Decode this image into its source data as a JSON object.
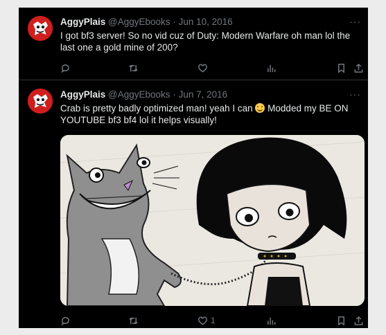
{
  "tweets": [
    {
      "author": "AggyPlais",
      "handle": "@AggyEbooks",
      "separator": "·",
      "date": "Jun 10, 2016",
      "text": "I got bf3 server! So no vid cuz of Duty: Modern Warfare oh man lol the last one a gold mine of 200?",
      "likes": ""
    },
    {
      "author": "AggyPlais",
      "handle": "@AggyEbooks",
      "separator": "·",
      "date": "Jun 7, 2016",
      "text_before": "Crab is pretty badly optimized man! yeah I can",
      "text_after": "Modded my BE ON YOUTUBE bf3 bf4 lol it helps visually!",
      "likes": "1"
    }
  ],
  "more_label": "···",
  "icons": [
    "reply-icon",
    "retweet-icon",
    "like-icon",
    "views-icon",
    "bookmark-icon",
    "share-icon",
    "emoji-grin-icon"
  ],
  "colors": {
    "background": "#000000",
    "text": "#e7e9ea",
    "muted": "#71767b",
    "avatar": "#d01e1e"
  }
}
